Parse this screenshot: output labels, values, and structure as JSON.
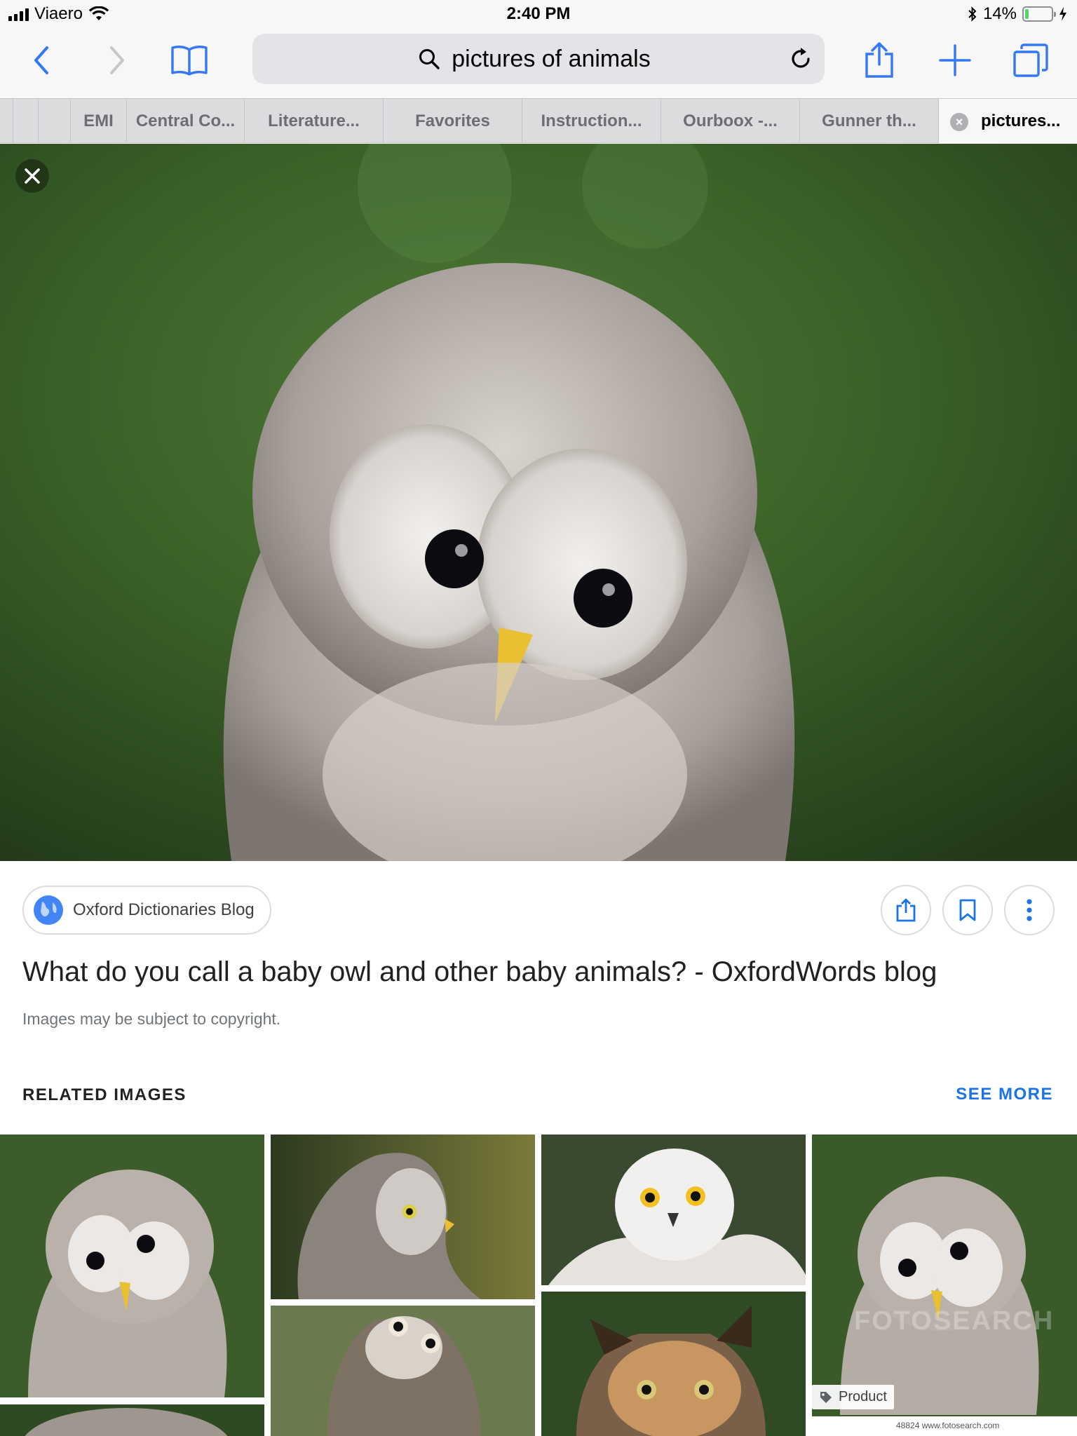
{
  "status": {
    "carrier": "Viaero",
    "time": "2:40 PM",
    "battery_pct": "14%",
    "battery_level": 0.14
  },
  "browser": {
    "search_query": "pictures of animals",
    "icons": [
      "back-icon",
      "forward-icon",
      "bookmarks-icon",
      "search-icon",
      "reload-icon",
      "share-icon",
      "new-tab-icon",
      "tabs-icon"
    ]
  },
  "tabs": [
    "EMI",
    "Central Co...",
    "Literature...",
    "Favorites",
    "Instruction...",
    "Ourboox -...",
    "Gunner th...",
    "pictures..."
  ],
  "result": {
    "source": "Oxford Dictionaries Blog",
    "title": "What do you call a baby owl and other baby animals? - OxfordWords blog",
    "copyright": "Images may be subject to copyright.",
    "related_heading": "RELATED IMAGES",
    "see_more": "SEE MORE"
  },
  "thumbnails": {
    "product_badge": "Product",
    "watermark": "FOTOSEARCH",
    "credit": "48824 www.fotosearch.com"
  },
  "colors": {
    "accent": "#1a73e8",
    "ios_blue": "#3478f6",
    "battery_green": "#4cd964"
  }
}
